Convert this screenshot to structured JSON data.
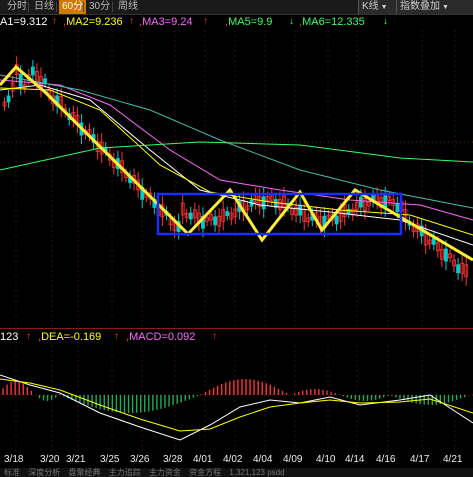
{
  "toolbar": {
    "tabs": [
      {
        "label": "分时",
        "active": false
      },
      {
        "label": "日线",
        "active": false
      },
      {
        "label": "60分",
        "active": true
      },
      {
        "label": "30分",
        "active": false
      },
      {
        "label": "周线",
        "active": false
      }
    ],
    "kline_label": "K线",
    "index_overlay_label": "指数叠加"
  },
  "ma_legend": [
    {
      "text": "A1=9.312",
      "arrow": "↑",
      "color": "#ffffff"
    },
    {
      "text": "MA2=9.236",
      "arrow": "↑",
      "color": "#ffff00"
    },
    {
      "text": "MA3=9.24",
      "arrow": "↑",
      "color": "#ff66ff"
    },
    {
      "text": "MA5=9.9",
      "arrow": "↓",
      "color": "#33ff66"
    },
    {
      "text": "MA6=12.335",
      "arrow": "↓",
      "color": "#33ff66"
    }
  ],
  "macd_legend": [
    {
      "text": "123",
      "arrow": "↑",
      "color": "#ffffff"
    },
    {
      "text": "DEA=-0.169",
      "arrow": "↑",
      "color": "#ffff00"
    },
    {
      "text": "MACD=0.092",
      "arrow": "↑",
      "color": "#ff66ff"
    }
  ],
  "dates": [
    "3/18",
    "3/20",
    "3/21",
    "3/25",
    "3/26",
    "3/28",
    "4/01",
    "4/02",
    "4/04",
    "4/09",
    "4/10",
    "4/14",
    "4/16",
    "4/17",
    "4/21"
  ],
  "bottom_tabs": [
    "标准",
    "深度分析",
    "盘聚经典",
    "主力追踪",
    "主力资金",
    "资金方程"
  ],
  "bottom_status": "1,321,123 psdd",
  "colors": {
    "up": "#ff3333",
    "down": "#00cccc",
    "pattern": "#ffee33",
    "box": "#1a2cff",
    "ma_white": "#ffffff",
    "ma_yellow": "#ffff00",
    "ma_pink": "#ff66ff",
    "ma_green": "#33ff66",
    "ma_teal": "#44bbaa"
  }
}
